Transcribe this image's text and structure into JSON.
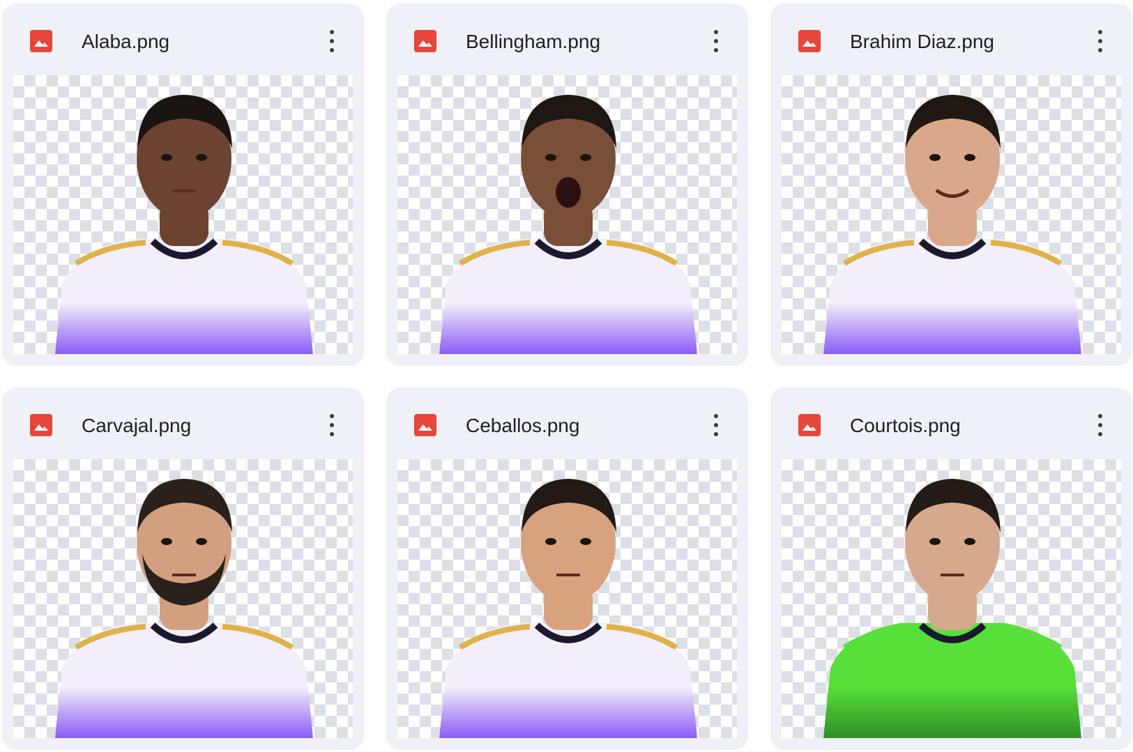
{
  "files": [
    {
      "name": "Alaba.png",
      "skin": "#6b4330",
      "hair": "#1b1511",
      "shirt": "#f3effa",
      "shirt_shade": "#8b5cf6",
      "trim": "#e0b24a",
      "mouth": "closed"
    },
    {
      "name": "Bellingham.png",
      "skin": "#7a4f37",
      "hair": "#1e1712",
      "shirt": "#f3effa",
      "shirt_shade": "#8b5cf6",
      "trim": "#e0b24a",
      "mouth": "open"
    },
    {
      "name": "Brahim Diaz.png",
      "skin": "#d9a88a",
      "hair": "#201813",
      "shirt": "#f3effa",
      "shirt_shade": "#8b5cf6",
      "trim": "#e0b24a",
      "mouth": "smile"
    },
    {
      "name": "Carvajal.png",
      "skin": "#d3a07f",
      "hair": "#2a211b",
      "shirt": "#f3effa",
      "shirt_shade": "#8b5cf6",
      "trim": "#e0b24a",
      "mouth": "beard"
    },
    {
      "name": "Ceballos.png",
      "skin": "#d8a27f",
      "hair": "#221a14",
      "shirt": "#f3effa",
      "shirt_shade": "#8b5cf6",
      "trim": "#e0b24a",
      "mouth": "closed"
    },
    {
      "name": "Courtois.png",
      "skin": "#d6a98c",
      "hair": "#231b15",
      "shirt": "#58e03a",
      "shirt_shade": "#2f8f25",
      "trim": "#58e03a",
      "mouth": "closed"
    }
  ],
  "icons": {
    "file_type": "image-file-icon",
    "more": "more-vert-icon"
  },
  "colors": {
    "card_bg": "#eef1f7",
    "file_icon": "#e8453c",
    "accent_purple": "#8b5cf6"
  }
}
